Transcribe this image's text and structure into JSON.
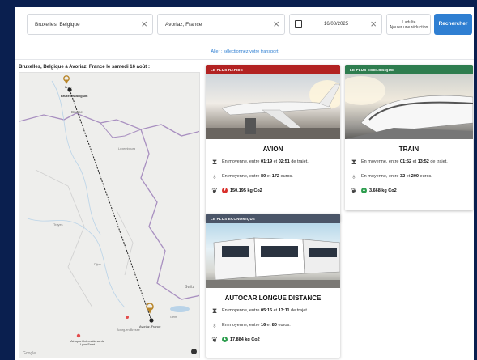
{
  "search": {
    "from": "Bruxelles, Belgique",
    "to": "Avoriaz, France",
    "date": "16/08/2025",
    "passengers_line1": "1 adulte",
    "passengers_line2": "Ajouter une réduction",
    "button": "Rechercher"
  },
  "aller_link": "Aller : sélectionnez votre transport",
  "route_title": "Bruxelles, Belgique à Avoriaz, France le samedi 16 août :",
  "map": {
    "labels": {
      "brussels": "Bruxelles-Belgium",
      "brussels_short": "Bru...",
      "brussel_city": "Brussel",
      "luxembourg": "Luxembourg",
      "troyes": "Troyes",
      "dijon": "Dijon",
      "bourg": "Bourg-en-Bresse",
      "lyon_airport": "Aéroport International de Lyon Saint",
      "avoriaz": "Avoriaz, France",
      "genf": "Genf",
      "switz": "Switz"
    },
    "logo": "Google",
    "info_icon": "i"
  },
  "cards": {
    "avion": {
      "band": "LE PLUS RAPIDE",
      "title": "AVION",
      "duration_pre": "En moyenne, entre ",
      "duration_min": "01:19",
      "duration_mid": " et ",
      "duration_max": "02:51",
      "duration_post": " de trajet.",
      "price_pre": "En moyenne, entre ",
      "price_min": "80",
      "price_mid": " et ",
      "price_max": "172",
      "price_post": " euros.",
      "co2": "150.195 kg Co2",
      "co2_color": "#d9302b",
      "band_color": "#b22222"
    },
    "train": {
      "band": "LE PLUS ECOLOGIQUE",
      "title": "TRAIN",
      "duration_pre": "En moyenne, entre ",
      "duration_min": "01:52",
      "duration_mid": " et ",
      "duration_max": "13:52",
      "duration_post": " de trajet.",
      "price_pre": "En moyenne, entre ",
      "price_min": "32",
      "price_mid": " et ",
      "price_max": "200",
      "price_post": " euros.",
      "co2": "3.668 kg Co2",
      "co2_color": "#2e9e4f",
      "band_color": "#2e7d4f"
    },
    "bus": {
      "band": "LE PLUS ECONOMIQUE",
      "title": "AUTOCAR LONGUE DISTANCE",
      "duration_pre": "En moyenne, entre ",
      "duration_min": "05:15",
      "duration_mid": " et ",
      "duration_max": "13:11",
      "duration_post": " de trajet.",
      "price_pre": "En moyenne, entre ",
      "price_min": "16",
      "price_mid": " et ",
      "price_max": "80",
      "price_post": " euros.",
      "co2": "17.884 kg Co2",
      "co2_color": "#2e9e4f",
      "band_color": "#4a5568"
    }
  },
  "icons": {
    "clear": "clear-icon",
    "calendar": "calendar-icon",
    "hourglass": "hourglass-icon",
    "money": "money-bag-icon",
    "leaf": "leaf-icon",
    "pin": "map-pin-icon"
  },
  "colors": {
    "background": "#0a1f4f",
    "primary": "#2f7fd2"
  }
}
